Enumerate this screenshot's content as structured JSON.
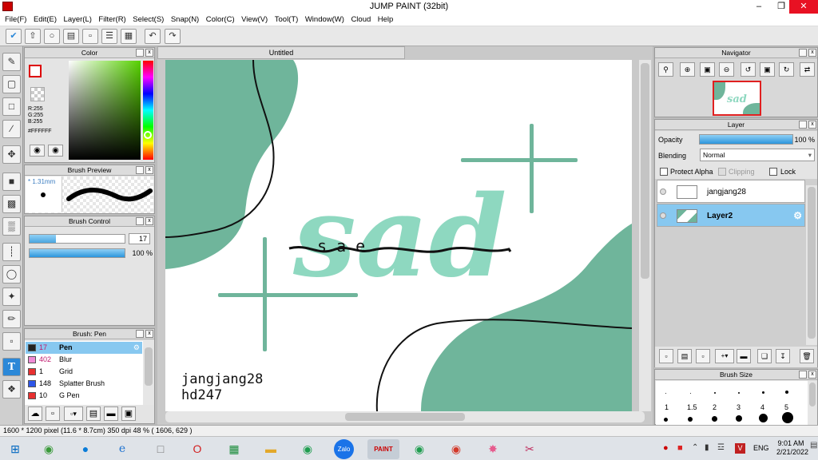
{
  "app": {
    "title": "JUMP PAINT (32bit)"
  },
  "menu": [
    "File(F)",
    "Edit(E)",
    "Layer(L)",
    "Filter(R)",
    "Select(S)",
    "Snap(N)",
    "Color(C)",
    "View(V)",
    "Tool(T)",
    "Window(W)",
    "Cloud",
    "Help"
  ],
  "color_panel": {
    "title": "Color",
    "r": "R:255",
    "g": "G:255",
    "b": "B:255",
    "hex": "#FFFFFF"
  },
  "brush_preview": {
    "title": "Brush Preview",
    "size": "1.31mm"
  },
  "brush_control": {
    "title": "Brush Control",
    "size_value": "17",
    "opacity_value": "100 %",
    "size_fraction": 0.28,
    "opacity_fraction": 1.0
  },
  "brush_list": {
    "title": "Brush: Pen",
    "items": [
      {
        "size": "17",
        "name": "Pen",
        "color": "#222222",
        "selected": true
      },
      {
        "size": "402",
        "name": "Blur",
        "color": "#f08ad6",
        "selected": false
      },
      {
        "size": "1",
        "name": "Grid",
        "color": "#e83030",
        "selected": false
      },
      {
        "size": "148",
        "name": "Splatter Brush",
        "color": "#2d55e8",
        "selected": false
      },
      {
        "size": "10",
        "name": "G Pen",
        "color": "#e83030",
        "selected": false
      }
    ]
  },
  "document": {
    "tab": "Untitled"
  },
  "canvas_text": {
    "line1": "jangjang28",
    "line2": "hd247",
    "word": "sad",
    "small_text": "s a e"
  },
  "navigator": {
    "title": "Navigator"
  },
  "layer_panel": {
    "title": "Layer",
    "opacity_label": "Opacity",
    "opacity_value": "100 %",
    "opacity_fraction": 1.0,
    "blending_label": "Blending",
    "blending_value": "Normal",
    "protect_alpha": "Protect Alpha",
    "clipping": "Clipping",
    "lock": "Lock",
    "layers": [
      {
        "name": "jangjang28",
        "selected": false
      },
      {
        "name": "Layer2",
        "selected": true
      }
    ]
  },
  "brush_size": {
    "title": "Brush Size",
    "labels": [
      "1",
      "1.5",
      "2",
      "3",
      "4",
      "5"
    ]
  },
  "status": {
    "text": "1600 * 1200 pixel   (11.6 * 8.7cm)  350 dpi   48 %   ( 1606, 629 )"
  },
  "taskbar": {
    "lang": "ENG",
    "time": "9:01 AM",
    "date": "2/21/2022"
  },
  "colors": {
    "accent": "#2b88d8",
    "teal": "#6fb59b",
    "teal_light": "#8ed8c0",
    "selected_row": "#87c8f0"
  }
}
